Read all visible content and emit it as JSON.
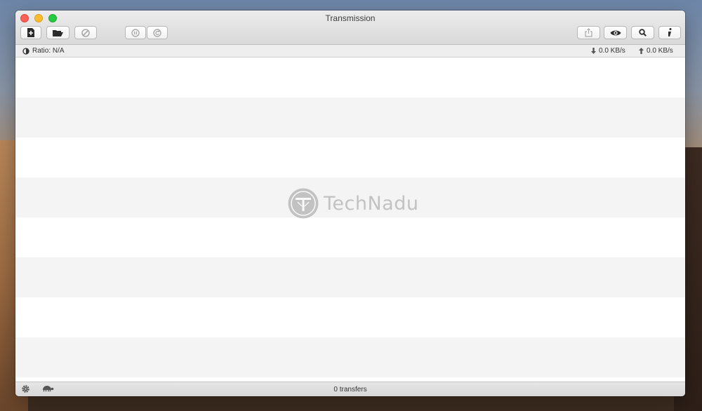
{
  "window": {
    "title": "Transmission"
  },
  "toolbar": {
    "create_torrent_icon": "document-plus-icon",
    "open_torrent_icon": "folder-icon",
    "remove_icon": "remove-icon",
    "pause_all_icon": "pause-icon",
    "resume_all_icon": "resume-icon",
    "share_icon": "share-icon",
    "quicklook_icon": "eye-icon",
    "filter_icon": "search-icon",
    "inspector_icon": "info-icon"
  },
  "status": {
    "ratio_text": "Ratio: N/A",
    "download_speed": "0.0 KB/s",
    "upload_speed": "0.0 KB/s"
  },
  "watermark": {
    "text": "TechNadu"
  },
  "footer": {
    "transfers": "0 transfers"
  },
  "colors": {
    "close": "#fc5f57",
    "minimize": "#fdbc2e",
    "maximize": "#28c840",
    "row_alt": "#f4f4f4"
  }
}
